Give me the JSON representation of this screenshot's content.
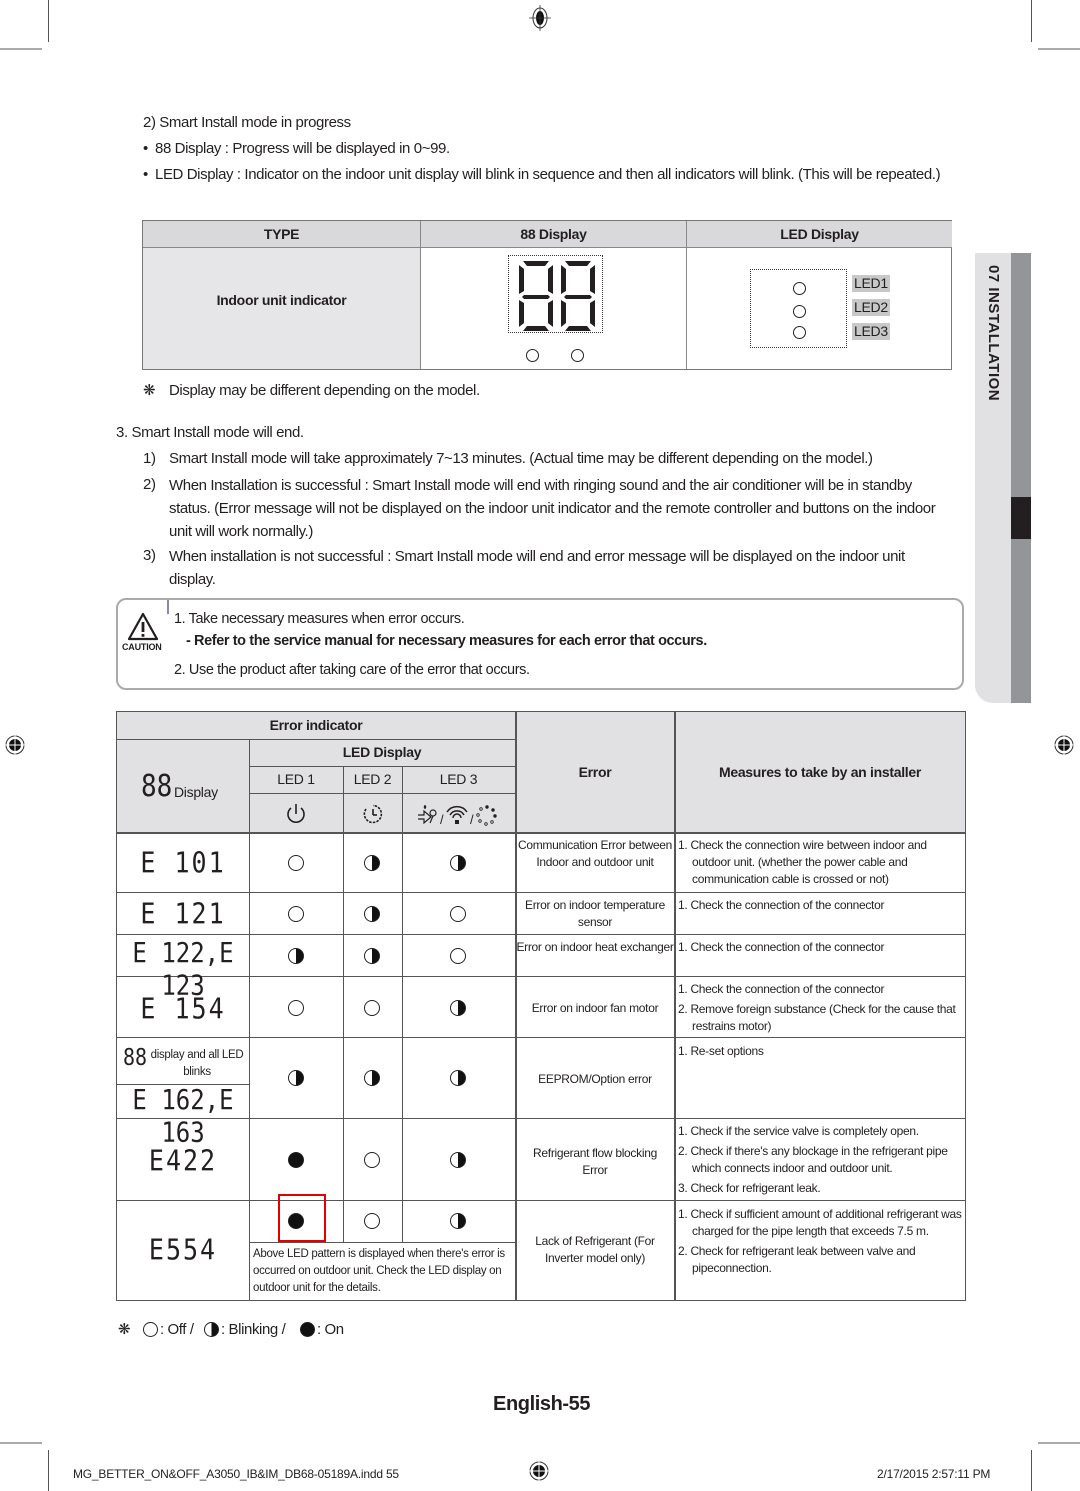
{
  "footer": {
    "filename": "MG_BETTER_ON&OFF_A3050_IB&IM_DB68-05189A.indd   55",
    "datetime": "2/17/2015   2:57:11 PM"
  },
  "side_tab": {
    "label": "07  INSTALLATION"
  },
  "section2": {
    "heading": "2)   Smart Install mode in progress",
    "bullets": [
      "88 Display : Progress will be displayed in 0~99.",
      "LED Display : Indicator on the indoor unit display will blink in sequence and then all indicators will blink. (This will be repeated.)"
    ]
  },
  "type_table": {
    "headers": [
      "TYPE",
      "88 Display",
      "LED Display"
    ],
    "row_label": "Indoor unit indicator",
    "seg_digits": "88",
    "led_labels": [
      "LED1",
      "LED2",
      "LED3"
    ]
  },
  "note_display": "Display may be different depending on the model.",
  "note_symbol": "❋",
  "section3": {
    "heading": "3.   Smart Install mode will end.",
    "items": [
      {
        "num": "1)",
        "text": "Smart Install mode will take approximately 7~13 minutes. (Actual time may be different depending on the model.)"
      },
      {
        "num": "2)",
        "text": "When Installation is successful : Smart Install mode will end with ringing sound and the air conditioner will be in standby status. (Error message will not be displayed on the indoor unit indicator and the remote controller and buttons on the indoor unit will work normally.)"
      },
      {
        "num": "3)",
        "text": "When installation is not successful : Smart Install mode will end and error message will be displayed on the indoor unit display."
      }
    ]
  },
  "caution": {
    "icon_label": "CAUTION",
    "line1": "1. Take necessary measures when error occurs.",
    "line2": "-  Refer to the service manual for necessary measures for each error that occurs.",
    "line3": "2. Use the product after taking care of the error that occurs."
  },
  "error_table": {
    "header_error_indicator": "Error indicator",
    "header_led_display": "LED Display",
    "header_88": "88",
    "header_display": "Display",
    "header_leds": [
      "LED 1",
      "LED 2",
      "LED 3"
    ],
    "header_error": "Error",
    "header_measures": "Measures to take by an installer",
    "led_icons": [
      "power-icon",
      "timer-icon",
      "fan-wifi-cycle-icon"
    ],
    "rows": [
      {
        "code": "E 101",
        "leds": [
          "off",
          "blink",
          "blink"
        ],
        "error": "Communication Error between Indoor and outdoor unit",
        "measures": [
          "1. Check the connection wire between indoor and outdoor unit. (whether the power cable and communication cable is crossed or not)"
        ]
      },
      {
        "code": "E 121",
        "leds": [
          "off",
          "blink",
          "off"
        ],
        "error": "Error on indoor temperature sensor",
        "measures": [
          "1. Check the connection of the connector"
        ]
      },
      {
        "code": "E 122,E 123",
        "leds": [
          "blink",
          "blink",
          "off"
        ],
        "error": "Error on indoor heat exchanger",
        "measures": [
          "1. Check the connection of the connector"
        ]
      },
      {
        "code": "E 154",
        "leds": [
          "off",
          "off",
          "blink"
        ],
        "error": "Error on indoor fan motor",
        "measures": [
          "1. Check the connection of the connector",
          "2. Remove foreign substance (Check for the cause that restrains motor)"
        ]
      },
      {
        "code_note": "display and all LED blinks",
        "code_88": "88",
        "code": "E 162,E 163",
        "leds": [
          "blink",
          "blink",
          "blink"
        ],
        "error": "EEPROM/Option error",
        "measures": [
          "1. Re-set options"
        ]
      },
      {
        "code": "E422",
        "leds": [
          "on",
          "off",
          "blink"
        ],
        "error": "Refrigerant flow blocking Error",
        "measures": [
          "1. Check if the service valve is completely open.",
          "2. Check if there's any blockage in the refrigerant pipe which connects indoor and outdoor unit.",
          "3. Check for refrigerant leak."
        ]
      },
      {
        "code": "E554",
        "leds": [
          "on",
          "off",
          "blink"
        ],
        "led_note": "Above LED pattern is displayed when there's error is occurred on outdoor unit. Check the LED display on outdoor unit for the details.",
        "error": "Lack of Refrigerant (For Inverter model only)",
        "measures": [
          "1. Check if sufficient amount of additional refrigerant was charged for the pipe length that exceeds 7.5 m.",
          "2. Check for refrigerant leak between valve and pipeconnection."
        ]
      }
    ]
  },
  "legend": {
    "off": ": Off /",
    "blink": ": Blinking /",
    "on": ": On"
  },
  "page_number": "English-55"
}
